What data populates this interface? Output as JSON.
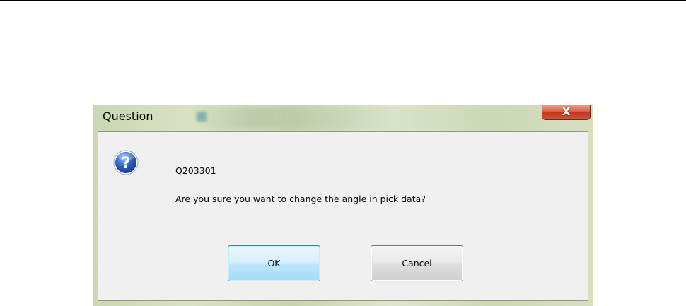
{
  "dialog": {
    "title": "Question",
    "close_icon": "close-icon",
    "close_glyph": "X",
    "icon": "question-icon",
    "code": "Q203301",
    "message": "Are you sure you want to change the angle in pick data?",
    "buttons": {
      "ok_label": "OK",
      "cancel_label": "Cancel"
    }
  },
  "colors": {
    "close_button": "#c2371d",
    "ok_button_border": "#3c7fb1",
    "question_icon": "#2456b8"
  }
}
